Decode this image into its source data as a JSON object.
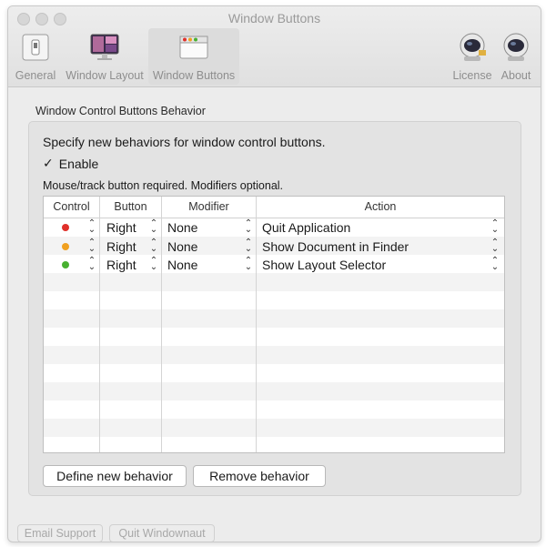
{
  "window": {
    "title": "Window Buttons"
  },
  "toolbar": {
    "items": [
      {
        "label": "General",
        "icon": "switch-icon"
      },
      {
        "label": "Window Layout",
        "icon": "monitor-icon"
      },
      {
        "label": "Window Buttons",
        "icon": "window-buttons-icon",
        "selected": true
      },
      {
        "label": "License",
        "icon": "astronaut-icon"
      },
      {
        "label": "About",
        "icon": "astronaut-icon"
      }
    ]
  },
  "behavior": {
    "group_title": "Window Control Buttons Behavior",
    "specify_text": "Specify new behaviors for window control buttons.",
    "enable_label": "Enable",
    "enable_checked": true,
    "note": "Mouse/track button required. Modifiers optional."
  },
  "table": {
    "headers": [
      "Control",
      "Button",
      "Modifier",
      "Action"
    ],
    "rows": [
      {
        "control_color": "#e0302a",
        "button": "Right",
        "modifier": "None",
        "action": "Quit Application"
      },
      {
        "control_color": "#f0a020",
        "button": "Right",
        "modifier": "None",
        "action": "Show Document in Finder"
      },
      {
        "control_color": "#48b030",
        "button": "Right",
        "modifier": "None",
        "action": "Show Layout Selector"
      }
    ]
  },
  "buttons": {
    "define": "Define new behavior",
    "remove": "Remove behavior"
  },
  "footer": {
    "email_support": "Email Support",
    "quit": "Quit Windownaut"
  }
}
